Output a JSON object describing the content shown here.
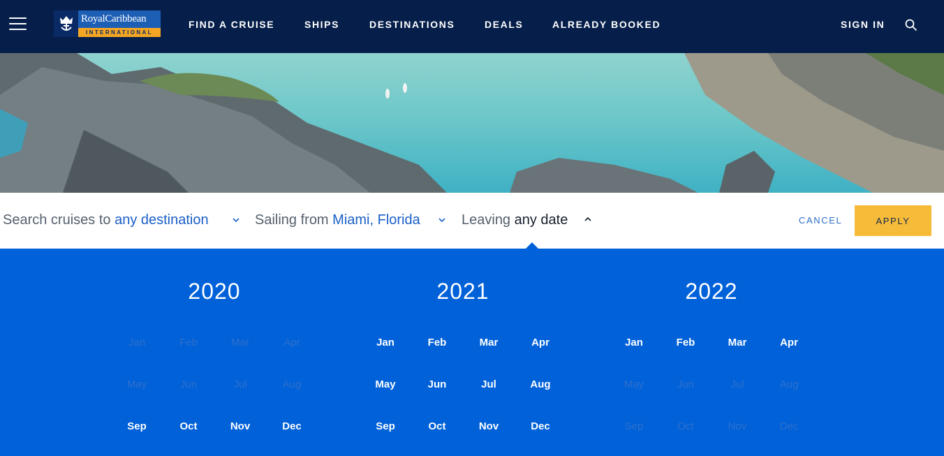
{
  "nav": {
    "brand_name": "RoyalCaribbean",
    "brand_sub": "INTERNATIONAL",
    "links": [
      "FIND A CRUISE",
      "SHIPS",
      "DESTINATIONS",
      "DEALS",
      "ALREADY BOOKED"
    ],
    "sign_in": "SIGN IN"
  },
  "filter": {
    "destination_prefix": "Search cruises to",
    "destination_value": "any destination",
    "port_prefix": "Sailing from",
    "port_value": "Miami, Florida",
    "date_prefix": "Leaving",
    "date_value": "any date",
    "cancel_label": "CANCEL",
    "apply_label": "APPLY"
  },
  "picker": {
    "years": [
      {
        "year": "2020",
        "months": [
          {
            "label": "Jan",
            "available": false
          },
          {
            "label": "Feb",
            "available": false
          },
          {
            "label": "Mar",
            "available": false
          },
          {
            "label": "Apr",
            "available": false
          },
          {
            "label": "May",
            "available": false
          },
          {
            "label": "Jun",
            "available": false
          },
          {
            "label": "Jul",
            "available": false
          },
          {
            "label": "Aug",
            "available": false
          },
          {
            "label": "Sep",
            "available": true
          },
          {
            "label": "Oct",
            "available": true
          },
          {
            "label": "Nov",
            "available": true
          },
          {
            "label": "Dec",
            "available": true
          }
        ]
      },
      {
        "year": "2021",
        "months": [
          {
            "label": "Jan",
            "available": true
          },
          {
            "label": "Feb",
            "available": true
          },
          {
            "label": "Mar",
            "available": true
          },
          {
            "label": "Apr",
            "available": true
          },
          {
            "label": "May",
            "available": true
          },
          {
            "label": "Jun",
            "available": true
          },
          {
            "label": "Jul",
            "available": true
          },
          {
            "label": "Aug",
            "available": true
          },
          {
            "label": "Sep",
            "available": true
          },
          {
            "label": "Oct",
            "available": true
          },
          {
            "label": "Nov",
            "available": true
          },
          {
            "label": "Dec",
            "available": true
          }
        ]
      },
      {
        "year": "2022",
        "months": [
          {
            "label": "Jan",
            "available": true
          },
          {
            "label": "Feb",
            "available": true
          },
          {
            "label": "Mar",
            "available": true
          },
          {
            "label": "Apr",
            "available": true
          },
          {
            "label": "May",
            "available": false
          },
          {
            "label": "Jun",
            "available": false
          },
          {
            "label": "Jul",
            "available": false
          },
          {
            "label": "Aug",
            "available": false
          },
          {
            "label": "Sep",
            "available": false
          },
          {
            "label": "Oct",
            "available": false
          },
          {
            "label": "Nov",
            "available": false
          },
          {
            "label": "Dec",
            "available": false
          }
        ]
      }
    ]
  },
  "colors": {
    "nav_bg": "#061f4a",
    "picker_bg": "#0061d9",
    "apply_bg": "#f7bb3a",
    "link_blue": "#1a5fc7"
  }
}
